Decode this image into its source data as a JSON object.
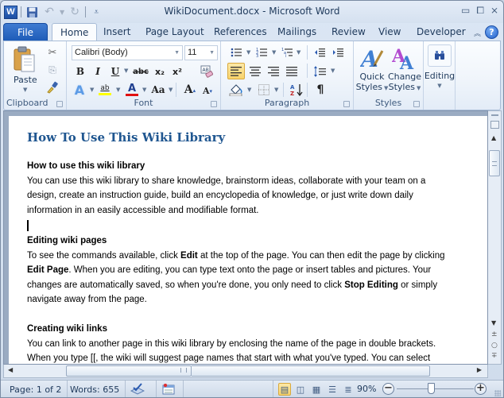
{
  "window": {
    "title": "WikiDocument.docx - Microsoft Word",
    "app_icon": "W"
  },
  "quick_access": {
    "items": [
      "save-icon",
      "undo-icon",
      "redo-icon",
      "customize-qat-icon"
    ]
  },
  "tabs": {
    "file": "File",
    "items": [
      "Home",
      "Insert",
      "Page Layout",
      "References",
      "Mailings",
      "Review",
      "View",
      "Developer"
    ],
    "active": "Home"
  },
  "ribbon": {
    "clipboard": {
      "label": "Clipboard",
      "paste": "Paste"
    },
    "font": {
      "label": "Font",
      "font_name": "Calibri (Body)",
      "font_size": "11",
      "bold": "B",
      "italic": "I",
      "underline": "U",
      "strikethrough": "abc",
      "subscript": "x₂",
      "superscript": "x²",
      "change_case": "Aa",
      "grow": "A",
      "shrink": "A",
      "highlight_color": "#ffff00",
      "font_color": "#e01010"
    },
    "paragraph": {
      "label": "Paragraph",
      "pilcrow": "¶"
    },
    "styles": {
      "label": "Styles",
      "quick_styles": [
        "Quick",
        "Styles"
      ],
      "change_styles": [
        "Change",
        "Styles"
      ]
    },
    "editing": {
      "label": "Editing"
    }
  },
  "document": {
    "title": "How To Use This Wiki Library",
    "sections": [
      {
        "heading": "How to use this wiki library",
        "lines": [
          "You can use this wiki library to share knowledge, brainstorm ideas, collaborate with your team on a",
          "design, create an instruction guide, build an encyclopedia of knowledge, or just write down daily",
          "information in an easily accessible and modifiable format."
        ]
      },
      {
        "heading": "Editing wiki pages",
        "line1_pre": "To see the commands available, click ",
        "line1_bold": "Edit",
        "line1_post": " at the top of the page. You can then edit the page by clicking",
        "line2_bold": "Edit Page",
        "line2_post": ". When you are editing, you can type text onto the page or insert tables and pictures. Your",
        "line3_pre": "changes are automatically saved, so when you're done, you only need to click ",
        "line3_bold": "Stop Editing",
        "line3_post": " or simply",
        "line4": "navigate away from the page."
      },
      {
        "heading": "Creating wiki links",
        "lines": [
          "You can link to another page in this wiki library by enclosing the name of the page in double brackets.",
          "When you type [[, the wiki will suggest page names that start with what you've typed. You can select"
        ]
      }
    ]
  },
  "statusbar": {
    "page": "Page: 1 of 2",
    "words": "Words: 655",
    "zoom": "90%",
    "zoom_level_percent": 90,
    "active_view": "print-layout"
  }
}
